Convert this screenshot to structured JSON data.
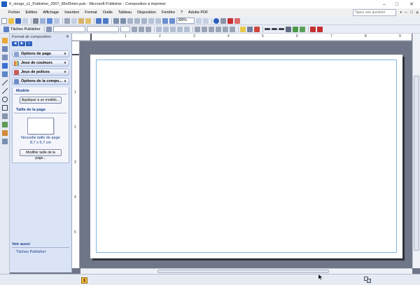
{
  "window": {
    "title": "fr_vierge_v1_Publisher_2007_85x55mm.pub - Microsoft Publisher - Composition à imprimer"
  },
  "menu": [
    "Fichier",
    "Edition",
    "Affichage",
    "Insertion",
    "Format",
    "Outils",
    "Tableau",
    "Disposition",
    "Fenêtre",
    "?",
    "Adobe PDF"
  ],
  "help": {
    "placeholder": "Tapez une question"
  },
  "toolbar": {
    "zoom": "300%",
    "tasks_label": "Tâches Publisher"
  },
  "taskpane": {
    "title": "Format de composition",
    "sections": [
      "Options de page",
      "Jeux de couleurs",
      "Jeux de polices",
      "Options de la compo..."
    ],
    "modele_title": "Modèle",
    "apply_template": "Appliquer à un modèle...",
    "size_title": "Taille de la page",
    "new_size_label": "Nouvelle taille de page",
    "new_size_dims": "8,7 x 5,7 cm",
    "modify_size": "Modifier taille de la page...",
    "see_also_title": "Voir aussi",
    "see_also_link": "Tâches Publisher"
  },
  "ruler": {
    "h": [
      "1",
      "2",
      "3",
      "4",
      "5",
      "6",
      "7",
      "8",
      "9"
    ],
    "v": [
      "1",
      "2",
      "3",
      "4",
      "5"
    ]
  },
  "status": {
    "page_number": "1"
  }
}
